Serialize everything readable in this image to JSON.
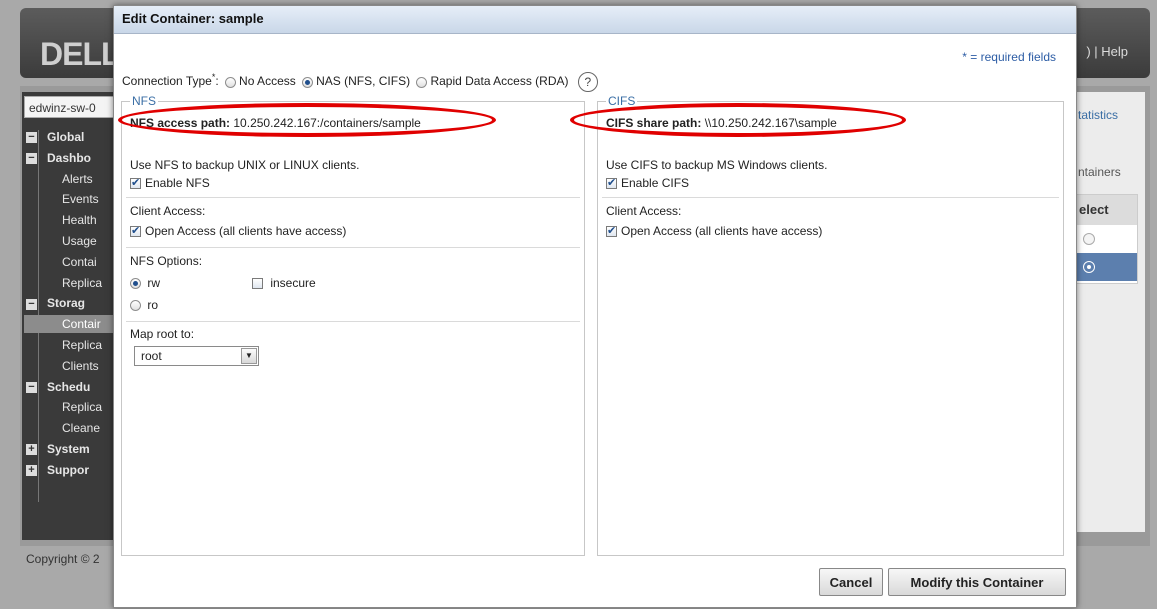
{
  "app": {
    "logo": "DELL",
    "header_links": ") | Help",
    "system_name": "edwinz-sw-0",
    "copyright": "Copyright © 2",
    "right_panel": {
      "statistics_link": "tatistics",
      "containers_label": "ntainers",
      "select_header": "elect"
    },
    "tree": [
      {
        "label": "Global ",
        "toggle": "−",
        "level": "top"
      },
      {
        "label": "Dashbo",
        "toggle": "−",
        "level": "top"
      },
      {
        "label": "Alerts",
        "level": "child"
      },
      {
        "label": "Events",
        "level": "child"
      },
      {
        "label": "Health",
        "level": "child"
      },
      {
        "label": "Usage",
        "level": "child"
      },
      {
        "label": "Contai",
        "level": "child"
      },
      {
        "label": "Replica",
        "level": "child"
      },
      {
        "label": "Storag",
        "toggle": "−",
        "level": "top"
      },
      {
        "label": "Contair",
        "level": "child",
        "selected": true
      },
      {
        "label": "Replica",
        "level": "child"
      },
      {
        "label": "Clients",
        "level": "child"
      },
      {
        "label": "Schedu",
        "toggle": "−",
        "level": "top"
      },
      {
        "label": "Replica",
        "level": "child"
      },
      {
        "label": "Cleane",
        "level": "child"
      },
      {
        "label": "System",
        "toggle": "+",
        "level": "top"
      },
      {
        "label": "Suppor",
        "toggle": "+",
        "level": "top"
      }
    ]
  },
  "dialog": {
    "title": "Edit Container: sample",
    "required_note": "* = required fields",
    "connection_type_label": "Connection Type",
    "connection_type_suffix": ":",
    "required_mark": "*",
    "options": {
      "no_access": "No Access",
      "nas": "NAS (NFS, CIFS)",
      "rda": "Rapid Data Access (RDA)"
    },
    "help_icon": "?",
    "nfs": {
      "legend": "NFS",
      "path_label": "NFS access path:",
      "path_value": " 10.250.242.167:/containers/sample",
      "description": "Use NFS to backup UNIX or LINUX clients.",
      "enable_label": "Enable NFS",
      "client_access_label": "Client Access:",
      "open_access_label": "Open Access (all clients have access)",
      "options_label": "NFS Options:",
      "rw_label": "rw",
      "ro_label": "ro",
      "insecure_label": "insecure",
      "map_root_label": "Map root to:",
      "map_root_value": "root"
    },
    "cifs": {
      "legend": "CIFS",
      "path_label": "CIFS share path:",
      "path_value": " \\\\10.250.242.167\\sample",
      "description": "Use CIFS to backup MS Windows clients.",
      "enable_label": "Enable CIFS",
      "client_access_label": "Client Access:",
      "open_access_label": "Open Access (all clients have access)"
    },
    "buttons": {
      "cancel": "Cancel",
      "modify": "Modify this Container"
    }
  }
}
